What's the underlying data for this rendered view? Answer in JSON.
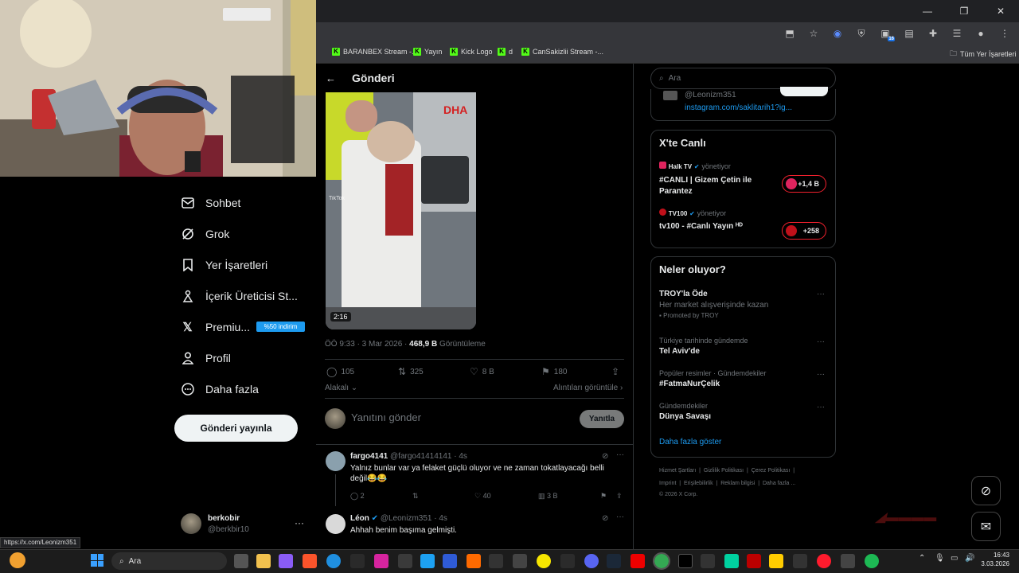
{
  "browser": {
    "bookmarks": [
      {
        "label": "BARANBEX Stream -..."
      },
      {
        "label": "Yayın"
      },
      {
        "label": "Kick Logo"
      },
      {
        "label": "d"
      },
      {
        "label": "CanSakizlii Stream -..."
      }
    ],
    "all_bookmarks": "Tüm Yer İşaretleri",
    "extension_badge": "16",
    "status_url": "https://x.com/Leonizm351"
  },
  "sidebar": {
    "items": [
      {
        "label": "Sohbet",
        "icon": "mail-icon"
      },
      {
        "label": "Grok",
        "icon": "grok-icon"
      },
      {
        "label": "Yer İşaretleri",
        "icon": "bookmark-icon"
      },
      {
        "label": "İçerik Üreticisi St...",
        "icon": "creator-icon"
      },
      {
        "label": "Premiu...",
        "icon": "x-logo-icon"
      },
      {
        "label": "Profil",
        "icon": "profile-icon"
      },
      {
        "label": "Daha fazla",
        "icon": "more-icon"
      }
    ],
    "premium_badge": "%50 indirim",
    "post_button": "Gönderi yayınla",
    "account": {
      "name": "berkobir",
      "handle": "@berkbir10"
    }
  },
  "post": {
    "header": "Gönderi",
    "video_duration": "2:16",
    "video_watermark": "TikTok",
    "video_banner": "DHA",
    "time": "ÖÖ 9:33 · 3 Mar 2026 · ",
    "views": "468,9 B",
    "views_label": " Görüntüleme",
    "replies": "105",
    "reposts": "325",
    "likes": "8 B",
    "bookmarks": "180",
    "sort_label": "Alakalı",
    "quotes_label": "Alıntıları görüntüle",
    "reply_placeholder": "Yanıtını gönder",
    "reply_button": "Yanıtla"
  },
  "comments": [
    {
      "name": "fargo4141",
      "handle": "@fargo41414141 · 4s",
      "text": "Yalnız bunlar var ya felaket güçlü oluyor ve ne zaman tokatlayacağı belli değil😂😂",
      "replies": "2",
      "likes": "40",
      "views": "3 B"
    },
    {
      "name": "Léon",
      "handle": "@Leonizm351 · 4s",
      "text": "Ahhah benim başıma gelmişti.",
      "replies": "",
      "likes": "",
      "views": ""
    }
  ],
  "right": {
    "search_placeholder": "Ara",
    "top_card": {
      "handle": "@Leonizm351",
      "link": "instagram.com/saklitarih1?ig..."
    },
    "live": {
      "title": "X'te Canlı",
      "items": [
        {
          "host": "Halk TV",
          "role": "yönetiyor",
          "title": "#CANLI | Gizem Çetin ile Parantez",
          "count": "+1,4 B"
        },
        {
          "host": "TV100",
          "role": "yönetiyor",
          "title": "tv100 - #Canlı Yayın ᴴᴰ",
          "count": "+258"
        }
      ]
    },
    "trends": {
      "title": "Neler oluyor?",
      "items": [
        {
          "context": "",
          "name": "TROY'la Öde",
          "sub": "Her market alışverişinde kazan",
          "promoted": "Promoted by TROY"
        },
        {
          "context": "Türkiye tarihinde gündemde",
          "name": "Tel Aviv'de",
          "sub": "",
          "promoted": ""
        },
        {
          "context": "Popüler resimler · Gündemdekiler",
          "name": "#FatmaNurÇelik",
          "sub": "",
          "promoted": ""
        },
        {
          "context": "Gündemdekiler",
          "name": "Dünya Savaşı",
          "sub": "",
          "promoted": ""
        }
      ],
      "show_more": "Daha fazla göster"
    },
    "footer": [
      "Hizmet Şartları",
      "Gizlilik Politikası",
      "Çerez Politikası",
      "Imprint",
      "Erişilebilirlik",
      "Reklam bilgisi",
      "Daha fazla ...",
      "© 2026 X Corp."
    ]
  },
  "taskbar": {
    "search": "Ara",
    "time": "16:43",
    "date": "3.03.2026"
  },
  "colors": {
    "accent": "#1d9bf0",
    "live": "#f4212e",
    "kick": "#53fc18"
  }
}
